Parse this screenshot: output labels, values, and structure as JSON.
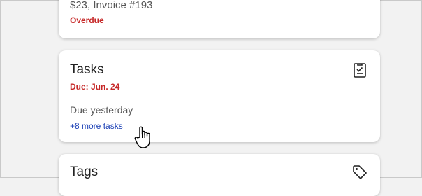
{
  "invoice_card": {
    "amount_text": "$23, Invoice #193",
    "status": "Overdue"
  },
  "tasks_card": {
    "title": "Tasks",
    "due_label": "Due: Jun. 24",
    "due_text": "Due yesterday",
    "more_link": "+8 more tasks",
    "icon": "checklist-icon"
  },
  "tags_card": {
    "title": "Tags",
    "icon": "tag-icon"
  },
  "colors": {
    "overdue_red": "#c62828",
    "link_blue": "#1a3fb5",
    "card_bg": "#ffffff",
    "page_bg": "#f2f2f2"
  },
  "cursor": "hand-pointer-cursor"
}
